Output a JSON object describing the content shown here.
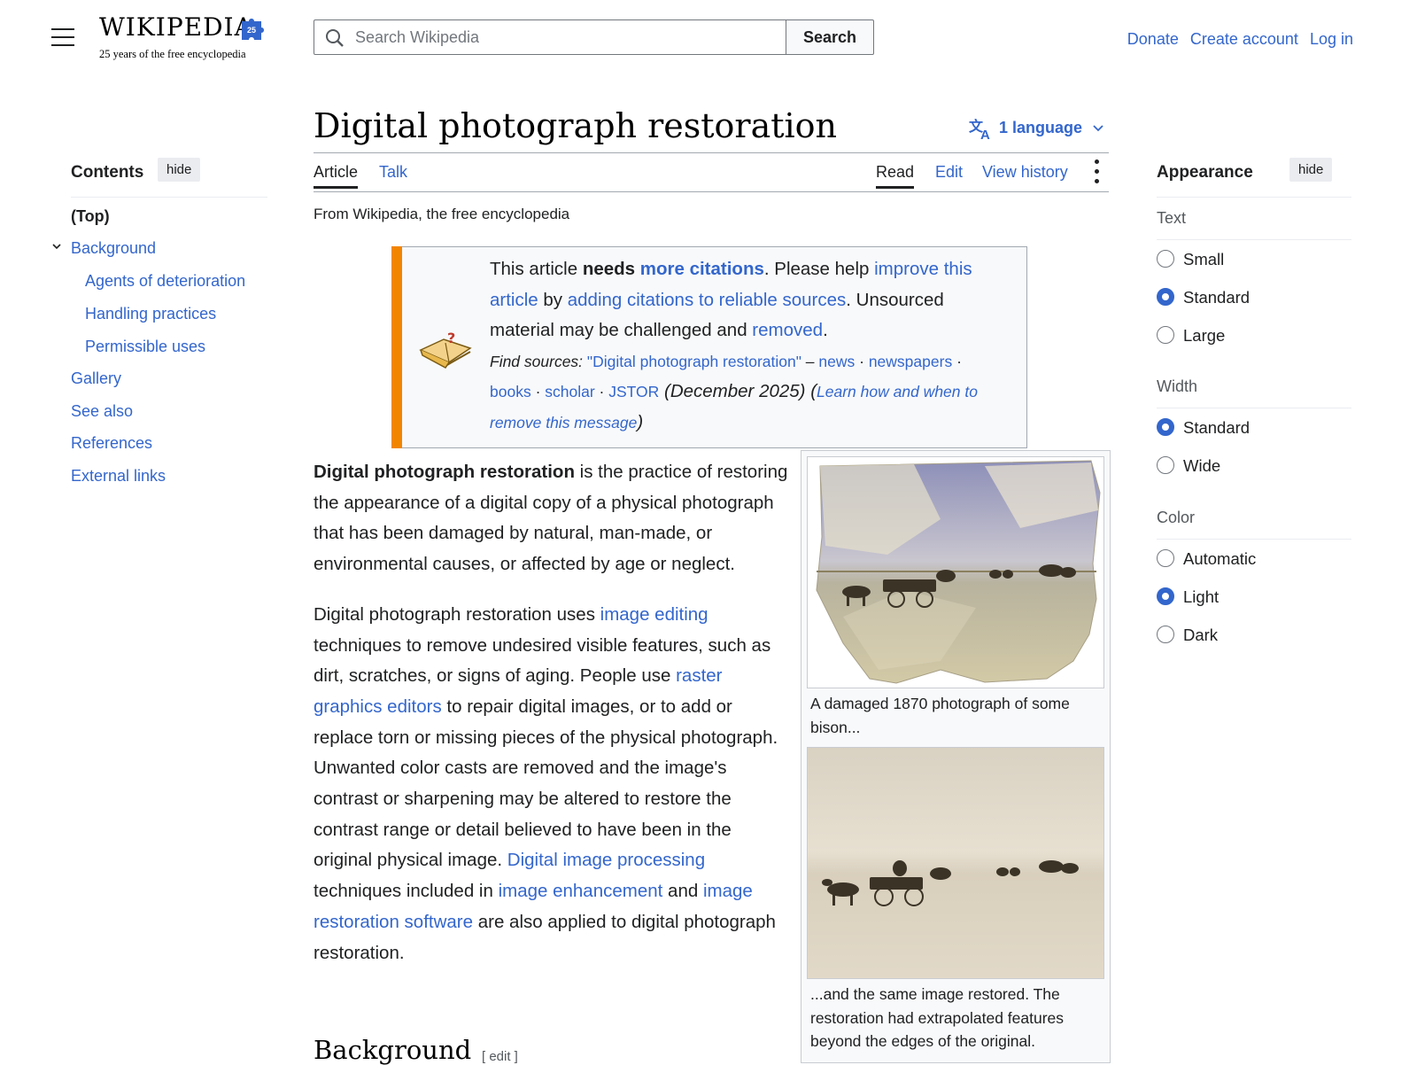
{
  "header": {
    "logo_wordmark": "WIKIPEDIA",
    "logo_badge": "25",
    "logo_tagline": "25 years of the free encyclopedia",
    "search_placeholder": "Search Wikipedia",
    "search_button": "Search",
    "links": {
      "donate": "Donate",
      "create_account": "Create account",
      "log_in": "Log in"
    }
  },
  "toc": {
    "heading": "Contents",
    "hide_label": "hide",
    "items": [
      {
        "label": "(Top)"
      },
      {
        "label": "Background"
      },
      {
        "label": "Agents of deterioration"
      },
      {
        "label": "Handling practices"
      },
      {
        "label": "Permissible uses"
      },
      {
        "label": "Gallery"
      },
      {
        "label": "See also"
      },
      {
        "label": "References"
      },
      {
        "label": "External links"
      }
    ]
  },
  "article": {
    "title": "Digital photograph restoration",
    "language_button": "1 language",
    "tabs": {
      "article": "Article",
      "talk": "Talk",
      "read": "Read",
      "edit": "Edit",
      "view_history": "View history"
    },
    "tagline": "From Wikipedia, the free encyclopedia",
    "ambox": {
      "t1": "This article ",
      "t2": "needs",
      "t3": " ",
      "l1": "more citations",
      "t4": ". Please help ",
      "l2": "improve this article",
      "t5": " by ",
      "l3": "adding citations to reliable sources",
      "t6": ". Unsourced material may be challenged and ",
      "l4": "removed",
      "t7": ".",
      "find_sources": "Find sources:",
      "fs_query": "\"Digital photograph restoration\"",
      "fs_dash": " – ",
      "fs_news": "news",
      "fs_newspapers": "newspapers",
      "fs_books": "books",
      "fs_scholar": "scholar",
      "fs_jstor": "JSTOR",
      "sep": " · ",
      "date": " (December 2025) (",
      "learn": "Learn how and when to remove this message",
      "close": ")"
    },
    "p1": {
      "bold": "Digital photograph restoration",
      "rest": " is the practice of restoring the appearance of a digital copy of a physical photograph that has been damaged by natural, man-made, or environmental causes, or affected by age or neglect."
    },
    "p2": {
      "s1": "Digital photograph restoration uses ",
      "l1": "image editing",
      "s2": " techniques to remove undesired visible features, such as dirt, scratches, or signs of aging. People use ",
      "l2": "raster graphics editors",
      "s3": " to repair digital images, or to add or replace torn or missing pieces of the physical photograph. Unwanted color casts are removed and the image's contrast or sharpening may be altered to restore the contrast range or detail believed to have been in the original physical image. ",
      "l3": "Digital image processing",
      "s4": " techniques included in ",
      "l4": "image enhancement",
      "s5": " and ",
      "l5": "image restoration software",
      "s6": " are also applied to digital photograph restoration."
    },
    "section_heading": "Background",
    "section_edit": "[ edit ]",
    "figure": {
      "caption1": "A damaged 1870 photograph of some bison...",
      "caption2": "...and the same image restored. The restoration had extrapolated features beyond the edges of the original."
    }
  },
  "appearance": {
    "heading": "Appearance",
    "hide_label": "hide",
    "text_group": "Text",
    "text_options": [
      "Small",
      "Standard",
      "Large"
    ],
    "text_selected": "Standard",
    "width_group": "Width",
    "width_options": [
      "Standard",
      "Wide"
    ],
    "width_selected": "Standard",
    "color_group": "Color",
    "color_options": [
      "Automatic",
      "Light",
      "Dark"
    ],
    "color_selected": "Light"
  },
  "colors": {
    "link": "#3366cc",
    "ambox_bar": "#f28500",
    "text": "#202122"
  }
}
